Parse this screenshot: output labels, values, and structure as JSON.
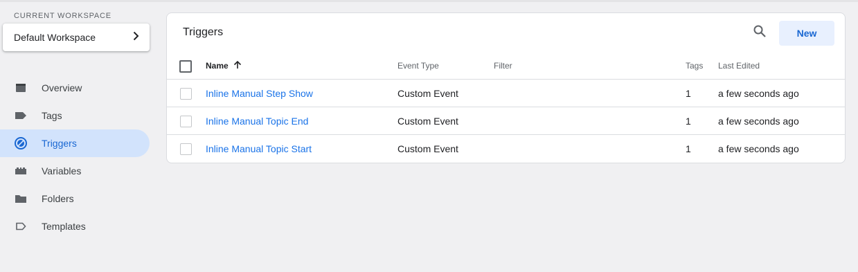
{
  "workspace": {
    "section_label": "CURRENT WORKSPACE",
    "name": "Default Workspace"
  },
  "nav": {
    "items": [
      {
        "label": "Overview",
        "icon": "overview-icon"
      },
      {
        "label": "Tags",
        "icon": "tag-icon"
      },
      {
        "label": "Triggers",
        "icon": "trigger-icon",
        "active": true
      },
      {
        "label": "Variables",
        "icon": "variables-icon"
      },
      {
        "label": "Folders",
        "icon": "folder-icon"
      },
      {
        "label": "Templates",
        "icon": "template-icon"
      }
    ]
  },
  "triggers": {
    "title": "Triggers",
    "new_label": "New",
    "columns": {
      "name": "Name",
      "event_type": "Event Type",
      "filter": "Filter",
      "tags": "Tags",
      "last_edited": "Last Edited"
    },
    "rows": [
      {
        "name": "Inline Manual Step Show",
        "event_type": "Custom Event",
        "filter": "",
        "tags": "1",
        "last_edited": "a few seconds ago"
      },
      {
        "name": "Inline Manual Topic End",
        "event_type": "Custom Event",
        "filter": "",
        "tags": "1",
        "last_edited": "a few seconds ago"
      },
      {
        "name": "Inline Manual Topic Start",
        "event_type": "Custom Event",
        "filter": "",
        "tags": "1",
        "last_edited": "a few seconds ago"
      }
    ]
  },
  "colors": {
    "accent": "#1a73e8",
    "active_bg": "#d2e3fc",
    "new_button_bg": "#e8f0fe",
    "page_bg": "#f0f0f2"
  }
}
